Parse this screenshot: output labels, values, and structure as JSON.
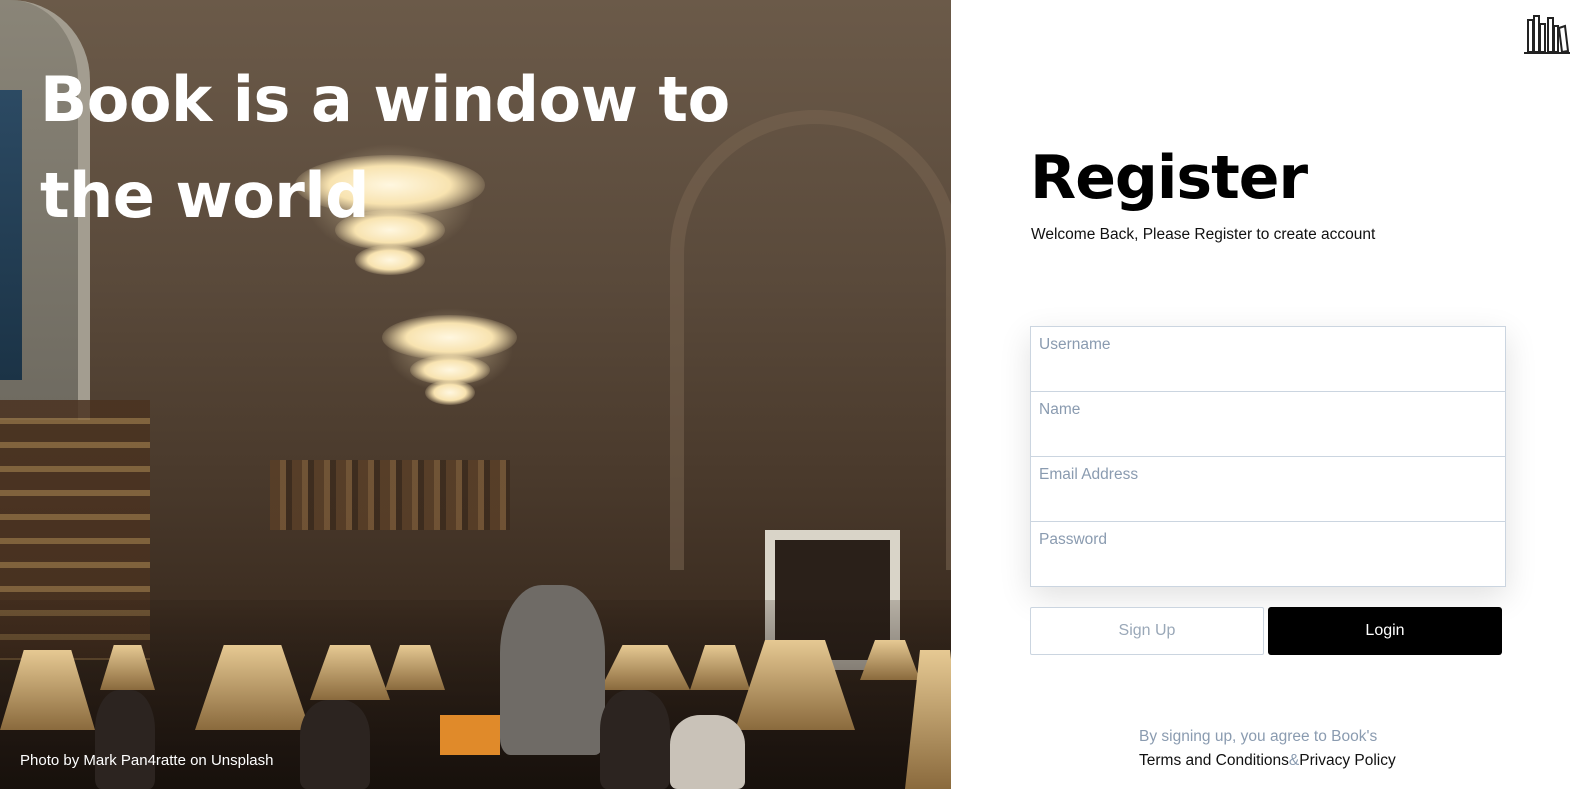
{
  "hero": {
    "title": "Book is a window to the world",
    "photo_credit": "Photo by Mark Pan4ratte on Unsplash"
  },
  "brand": {
    "logo_icon": "bookshelf-icon"
  },
  "register": {
    "title": "Register",
    "subtitle": "Welcome Back, Please Register to create account"
  },
  "form": {
    "username_placeholder": "Username",
    "name_placeholder": "Name",
    "email_placeholder": "Email Address",
    "password_placeholder": "Password"
  },
  "buttons": {
    "signup_label": "Sign Up",
    "login_label": "Login"
  },
  "terms": {
    "agree_text": "By signing up, you agree to Book's",
    "terms_link": "Terms and Conditions",
    "ampersand": "&",
    "privacy_link": "Privacy Policy"
  },
  "colors": {
    "primary_button": "#000000",
    "muted_text": "#8a9bb0",
    "input_border": "#cbd5e0"
  }
}
